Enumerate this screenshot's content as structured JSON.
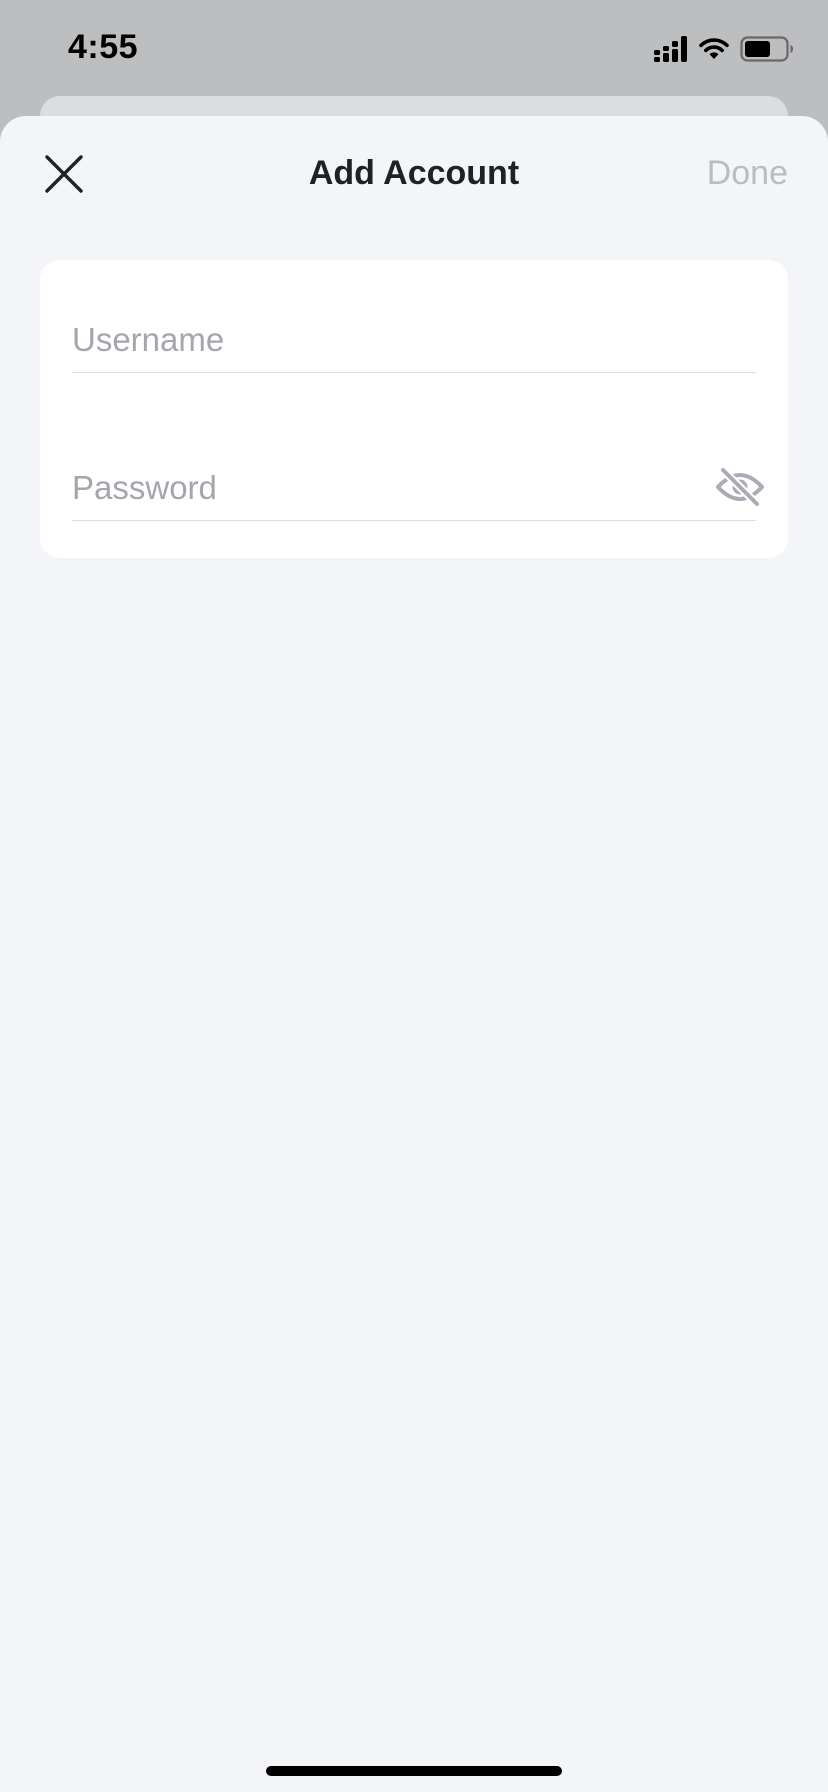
{
  "status_bar": {
    "time": "4:55",
    "icons": [
      "cellular-signal-icon",
      "wifi-icon",
      "battery-icon"
    ]
  },
  "sheet": {
    "title": "Add Account",
    "close_icon": "close-icon",
    "done_label": "Done"
  },
  "form": {
    "username": {
      "value": "",
      "placeholder": "Username"
    },
    "password": {
      "value": "",
      "placeholder": "Password",
      "toggle_icon": "eye-slash-icon"
    }
  },
  "colors": {
    "background": "#f3f5f9",
    "card": "#ffffff",
    "title": "#1f2125",
    "done_disabled": "#b9bcc2",
    "placeholder": "#a3a6ac"
  }
}
